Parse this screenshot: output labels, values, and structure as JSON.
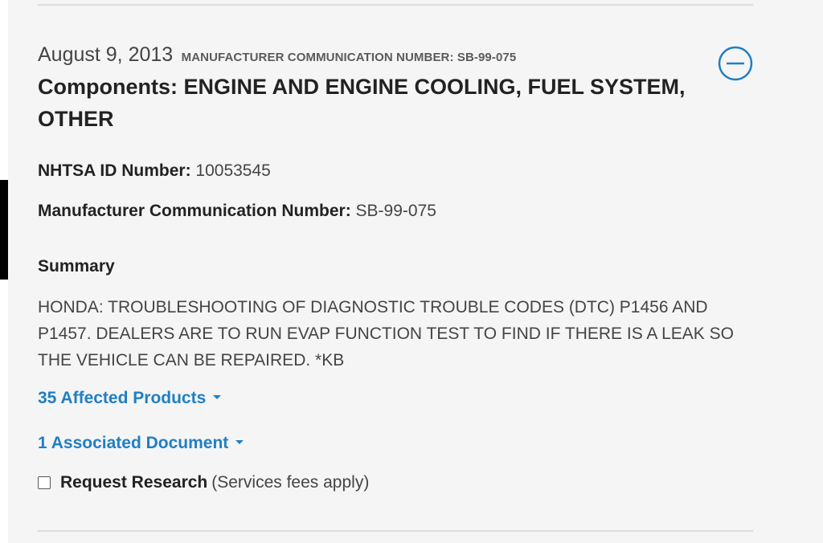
{
  "record": {
    "date": "August 9, 2013",
    "mcn_header": "MANUFACTURER COMMUNICATION NUMBER: SB-99-075",
    "components": "Components: ENGINE AND ENGINE COOLING, FUEL SYSTEM, OTHER",
    "nhtsa_id": {
      "label": "NHTSA ID Number:",
      "value": "10053545"
    },
    "manufacturer_comm": {
      "label": "Manufacturer Communication Number:",
      "value": "SB-99-075"
    },
    "summary": {
      "heading": "Summary",
      "text": "HONDA: TROUBLESHOOTING OF DIAGNOSTIC TROUBLE CODES (DTC) P1456 AND P1457. DEALERS ARE TO RUN EVAP FUNCTION TEST TO FIND IF THERE IS A LEAK SO THE VEHICLE CAN BE REPAIRED. *KB"
    },
    "affected_products_link": "35 Affected Products",
    "associated_document_link": "1 Associated Document",
    "request_research": {
      "label": "Request Research",
      "note": "(Services fees apply)",
      "checked": false
    }
  },
  "icons": {
    "collapse": "minus-circle-icon",
    "dropdown": "caret-down-icon"
  },
  "colors": {
    "link": "#1f7fc4",
    "background": "#f5f5f5",
    "text": "#222222"
  }
}
